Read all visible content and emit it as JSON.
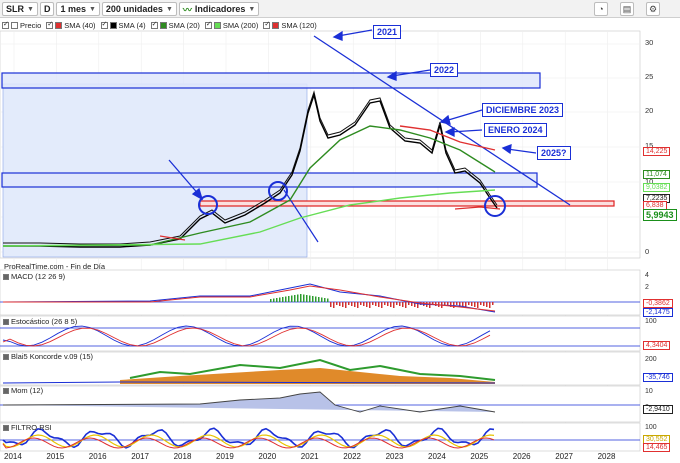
{
  "toolbar": {
    "symbol": "SLR",
    "d_label": "D",
    "period": "1 mes",
    "units": "200 unidades",
    "indicators": "Indicadores",
    "right_icons": [
      "clock-icon",
      "panels-icon",
      "settings-icon"
    ]
  },
  "legend": [
    {
      "label": "Precio",
      "color": "#ffffff"
    },
    {
      "label": "SMA (40)",
      "color": "#e03030"
    },
    {
      "label": "SMA (4)",
      "color": "#000000"
    },
    {
      "label": "SMA (20)",
      "color": "#2e8b20"
    },
    {
      "label": "SMA (200)",
      "color": "#66dd55"
    },
    {
      "label": "SMA (120)",
      "color": "#dd3030"
    }
  ],
  "price_scale": [
    "30",
    "25",
    "20",
    "15",
    "10",
    "5",
    "0"
  ],
  "price_boxes": [
    {
      "text": "14,225",
      "color": "#e03030"
    },
    {
      "text": "11,074",
      "color": "#2e8b20"
    },
    {
      "text": "9,0382",
      "color": "#66dd55"
    },
    {
      "text": "7,2235",
      "color": "#222222"
    },
    {
      "text": "6,838",
      "color": "#e03030"
    },
    {
      "text": "5,9943",
      "color": "#1a8f1a"
    }
  ],
  "annotations": [
    "2021",
    "2022",
    "DICIEMBRE 2023",
    "ENERO 2024",
    "2025?"
  ],
  "footer_note": "ProRealTime.com - Fin de Día",
  "panels": [
    {
      "name": "MACD (12 26 9)",
      "scale": [
        "4",
        "2",
        "0"
      ],
      "values": [
        {
          "text": "-0,3862",
          "color": "#e03030"
        },
        {
          "text": "-2,1475",
          "color": "#1a2fd6"
        }
      ]
    },
    {
      "name": "Estocástico (26 8 5)",
      "scale": [
        "100",
        "0"
      ],
      "values": [
        {
          "text": "4,3404",
          "color": "#e03030"
        }
      ]
    },
    {
      "name": "Blai5 Koncorde v.09 (15)",
      "scale": [
        "200",
        "0"
      ],
      "values": [
        {
          "text": "-35,746",
          "color": "#1a2fd6"
        }
      ]
    },
    {
      "name": "Mom (12)",
      "scale": [
        "10",
        "0"
      ],
      "values": [
        {
          "text": "-2,9410",
          "color": "#222222"
        }
      ]
    },
    {
      "name": "FILTRO RSI",
      "scale": [
        "100"
      ],
      "values": [
        {
          "text": "30,552",
          "color": "#c9a800"
        },
        {
          "text": "14,465",
          "color": "#e03030"
        }
      ]
    }
  ],
  "x_axis": [
    "2014",
    "2015",
    "2016",
    "2017",
    "2018",
    "2019",
    "2020",
    "2021",
    "2022",
    "2023",
    "2024",
    "2025",
    "2026",
    "2027",
    "2028"
  ]
}
